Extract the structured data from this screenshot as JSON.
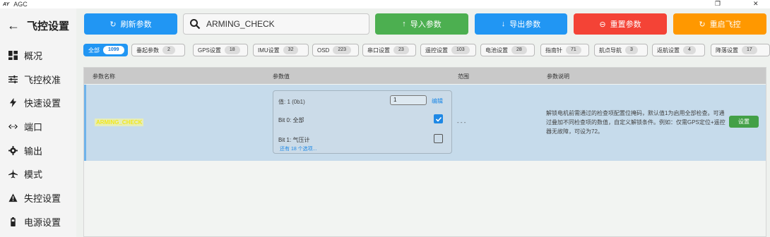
{
  "window": {
    "logo": "AY",
    "title": "AGC",
    "restore_glyph": "❐",
    "close_glyph": "✕"
  },
  "sidebar": {
    "back_glyph": "←",
    "title": "飞控设置",
    "items": [
      {
        "label": "概况",
        "icon": "dashboard-icon"
      },
      {
        "label": "飞控校准",
        "icon": "sliders-icon"
      },
      {
        "label": "快速设置",
        "icon": "bolt-icon"
      },
      {
        "label": "端口",
        "icon": "ports-icon"
      },
      {
        "label": "输出",
        "icon": "gear-icon"
      },
      {
        "label": "模式",
        "icon": "airplane-icon"
      },
      {
        "label": "失控设置",
        "icon": "warning-icon"
      },
      {
        "label": "电源设置",
        "icon": "battery-icon"
      }
    ]
  },
  "toolbar": {
    "refresh": {
      "label": "刷新参数",
      "glyph": "↻",
      "color": "#2196f3"
    },
    "import": {
      "label": "导入参数",
      "glyph": "↑",
      "color": "#4caf50"
    },
    "export": {
      "label": "导出参数",
      "glyph": "↓",
      "color": "#2196f3"
    },
    "reset": {
      "label": "重置参数",
      "glyph": "⊖",
      "color": "#f44336"
    },
    "reboot": {
      "label": "重启飞控",
      "glyph": "↻",
      "color": "#ff9800"
    },
    "search_value": "ARMING_CHECK"
  },
  "chips": [
    {
      "label": "全部",
      "count": "1099",
      "active": true
    },
    {
      "label": "垂起参数",
      "count": "2"
    },
    {
      "label": "GPS设置",
      "count": "18"
    },
    {
      "label": "IMU设置",
      "count": "32"
    },
    {
      "label": "OSD",
      "count": "223"
    },
    {
      "label": "串口设置",
      "count": "23"
    },
    {
      "label": "遥控设置",
      "count": "103"
    },
    {
      "label": "电池设置",
      "count": "28"
    },
    {
      "label": "指南针",
      "count": "71"
    },
    {
      "label": "航点导航",
      "count": "3"
    },
    {
      "label": "返航设置",
      "count": "4"
    },
    {
      "label": "降落设置",
      "count": "17"
    }
  ],
  "table": {
    "headers": {
      "name": "参数名称",
      "value": "参数值",
      "range": "范围",
      "desc": "参数说明"
    },
    "row": {
      "name": "ARMING_CHECK",
      "value_label": "值: 1 (0b1)",
      "value_input": "1",
      "edit_label": "编辑",
      "bits": [
        {
          "label": "Bit 0: 全部",
          "checked": true
        },
        {
          "label": "Bit 1: 气压计",
          "checked": false
        }
      ],
      "more_label": "还有 18 个选项...",
      "range": "- - -",
      "description": "解锁电机前需通过的检查项配置位掩码，默认值1为启用全部检查。可通过叠加不同检查项的数值，自定义解锁条件。例如：仅需GPS定位+遥控器无故障，可设为72。",
      "set_label": "设置"
    }
  }
}
